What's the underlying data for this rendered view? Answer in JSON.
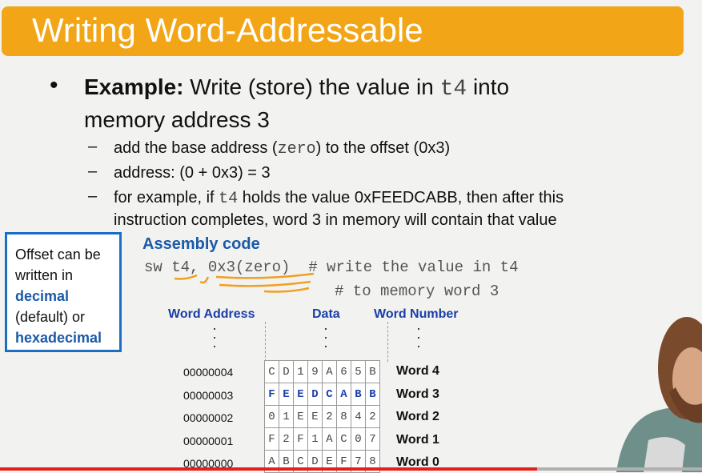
{
  "title": "Writing Word-Addressable",
  "bullet": {
    "label": "Example:",
    "text_pre": "Write (store) the value in",
    "reg": "t4",
    "text_post": "into",
    "line2": "memory address 3"
  },
  "subs": [
    {
      "pre": "add the base address (",
      "code": "zero",
      "post": ") to the offset (0x3)"
    },
    {
      "text": "address: (0 + 0x3) = 3"
    },
    {
      "pre": "for example, if",
      "code": "t4",
      "post": "holds the value 0xFEEDCABB, then after this",
      "line2": "instruction completes, word 3 in memory will contain that value"
    }
  ],
  "note": {
    "l1": "Offset can be",
    "l2": "written in",
    "l3": "decimal",
    "l4": "(default) or",
    "l5": "hexadecimal"
  },
  "asm": {
    "heading": "Assembly code",
    "line1": "sw t4, 0x3(zero)  # write the value in t4",
    "line2": "# to memory word 3"
  },
  "memory": {
    "headers": {
      "address": "Word Address",
      "data": "Data",
      "number": "Word Number"
    },
    "rows": [
      {
        "address": "00000004",
        "data": [
          "C",
          "D",
          "1",
          "9",
          "A",
          "6",
          "5",
          "B"
        ],
        "word": "Word 4"
      },
      {
        "address": "00000003",
        "data": [
          "F",
          "E",
          "E",
          "D",
          "C",
          "A",
          "B",
          "B"
        ],
        "word": "Word 3"
      },
      {
        "address": "00000002",
        "data": [
          "0",
          "1",
          "E",
          "E",
          "2",
          "8",
          "4",
          "2"
        ],
        "word": "Word 2"
      },
      {
        "address": "00000001",
        "data": [
          "F",
          "2",
          "F",
          "1",
          "A",
          "C",
          "0",
          "7"
        ],
        "word": "Word 1"
      },
      {
        "address": "00000000",
        "data": [
          "A",
          "B",
          "C",
          "D",
          "E",
          "F",
          "7",
          "8"
        ],
        "word": "Word 0"
      }
    ]
  },
  "colors": {
    "title_bar": "#f2a516",
    "accent_blue": "#1a5aa8",
    "ink_orange": "#f0a020",
    "progress": "#e3201c"
  },
  "video_progress": 0.765
}
